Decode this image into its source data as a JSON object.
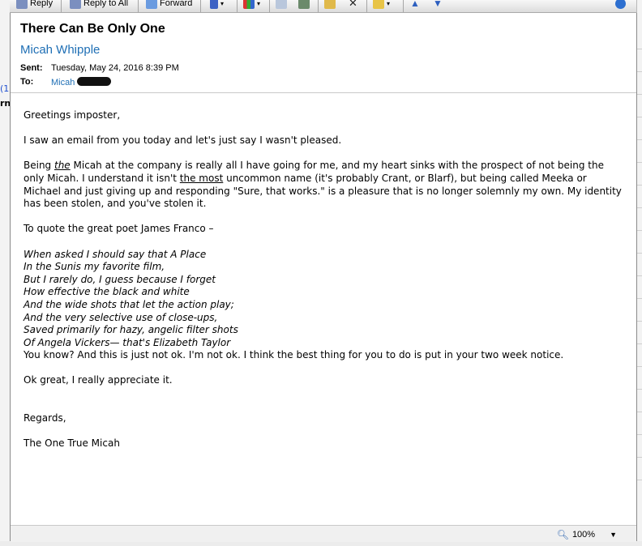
{
  "toolbar": {
    "reply": "Reply",
    "reply_all": "Reply to All",
    "forward": "Forward",
    "help_icon": "help-icon"
  },
  "background": {
    "left_frag_1": "(1",
    "left_frag_2": "rn"
  },
  "message": {
    "subject": "There Can Be Only One",
    "sender_name": "Micah Whipple",
    "sent_label": "Sent:",
    "sent_value": "Tuesday, May 24, 2016 8:39 PM",
    "to_label": "To:",
    "to_value": "Micah"
  },
  "body": {
    "greeting": "Greetings imposter,",
    "p1": "I saw an email from you today and let's just say I wasn't pleased.",
    "p2_a": "Being ",
    "p2_the": "the",
    "p2_b": " Micah at the company is really all I have going for me, and my heart sinks with the prospect of not being the only Micah. I understand it isn't ",
    "p2_most": "the most",
    "p2_c": " uncommon name (it's probably Crant, or Blarf), but being called Meeka or Michael and just giving up and responding \"Sure, that works.\" is a pleasure that is no longer solemnly my own. My identity has been stolen, and you've stolen it.",
    "p3": "To quote the great poet James Franco –",
    "poem": [
      "When asked I should say that A Place",
      "In the Sunis my favorite film,",
      "But I rarely do, I guess because I forget",
      "How effective the black and white",
      "And the wide shots that let the action play;",
      "And the very selective use of close-ups,",
      "Saved primarily for hazy, angelic filter shots",
      "Of Angela Vickers— that's Elizabeth Taylor"
    ],
    "p4": "You know? And this is just not ok. I'm not ok. I think the best thing for you to do is put in your two week notice.",
    "p5": "Ok great, I really appreciate it.",
    "closing": "Regards,",
    "signature": "The One True Micah"
  },
  "status": {
    "zoom": "100%"
  }
}
